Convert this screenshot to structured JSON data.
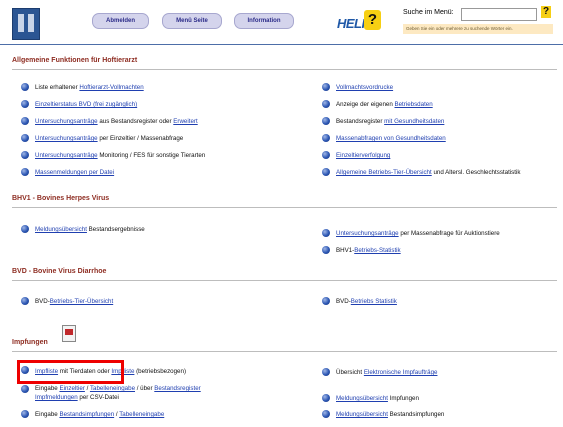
{
  "header": {
    "nav": {
      "abmelden": "Abmelden",
      "menu": "Menü Seite",
      "info": "Information"
    },
    "help_text": "HELP",
    "help_q": "?",
    "search": {
      "label": "Suche im Menü:",
      "placeholder": "",
      "hint": "Geben Sie ein oder mehrere zu suchende Wörter ein.",
      "q": "?"
    }
  },
  "sections": {
    "s1": "Allgemeine Funktionen für Hoftierarzt",
    "s2": "BHV1 - Bovines Herpes Virus",
    "s3": "BVD - Bovine Virus Diarrhoe",
    "s4": "Impfungen"
  },
  "left": {
    "l1_pre": "Liste erhaltener ",
    "l1_link": "Hoftierarzt-Vollmachten",
    "l2_link": "Einzeltierstatus BVD (frei zugänglich)",
    "l3_link": "Untersuchungsanträge",
    "l3_mid": " aus Bestandsregister oder ",
    "l3_link2": "Erweitert",
    "l4_link": "Untersuchungsanträge",
    "l4_post": " per Einzeltier / Massenabfrage",
    "l5_link": "Untersuchungsanträge",
    "l5_post": " Monitoring / FES für sonstige Tierarten",
    "l6_link": "Massenmeldungen per Datei",
    "b1_link": "Meldungsübersicht",
    "b1_post": " Bestandsergebnisse",
    "v1_pre": "BVD-",
    "v1_link": "Betriebs-Tier-Übersicht",
    "i1_link": "Impfliste",
    "i1_mid": " mit Tierdaten oder ",
    "i1_link2": "Impfliste",
    "i1_post": " (betriebsbezogen)",
    "i2_pre": "Eingabe ",
    "i2_link1": "Einzeltier",
    "i2_sep": " / ",
    "i2_link2": "Tabelleneingabe",
    "i2_mid": " / über ",
    "i2_link3": "Bestandsregister",
    "i2b_link": "Impfmeldungen",
    "i2b_post": " per CSV-Datei",
    "i3_pre": "Eingabe ",
    "i3_link1": "Bestandsimpfungen",
    "i3_sep": " / ",
    "i3_link2": "Tabelleneingabe"
  },
  "right": {
    "r1_link": "Vollmachtsvordrucke",
    "r2_pre": "Anzeige der eigenen ",
    "r2_link": "Betriebsdaten",
    "r3_pre": "Bestandsregister ",
    "r3_link": "mit Gesundheitsdaten",
    "r4_link": "Massenabfragen von Gesundheitsdaten",
    "r5_link": "Einzeltierverfolgung",
    "r6_link": "Allgemeine Betriebs-Tier-Übersicht",
    "r6_post": " und Altersl. Geschlechtsstatistik",
    "b1_link": "Untersuchungsanträge",
    "b1_post": " per Massenabfrage für Auktionstiere",
    "b2_pre": "BHV1-",
    "b2_link": "Betriebs-Statistik",
    "v1_pre": "BVD-",
    "v1_link": "Betriebs Statistik",
    "i1_pre": "Übersicht ",
    "i1_link": "Elektronische Impfaufträge",
    "i2_link": "Meldungsübersicht",
    "i2_post": " Impfungen",
    "i3_link": "Meldungsübersicht",
    "i3_post": " Bestandsimpfungen"
  },
  "colors": {
    "section_title": "#8e2d22",
    "link": "#1f3fb0",
    "highlight": "#ee0000",
    "nav_bg": "#d4d4ec",
    "help_yellow": "#f6cf13"
  }
}
